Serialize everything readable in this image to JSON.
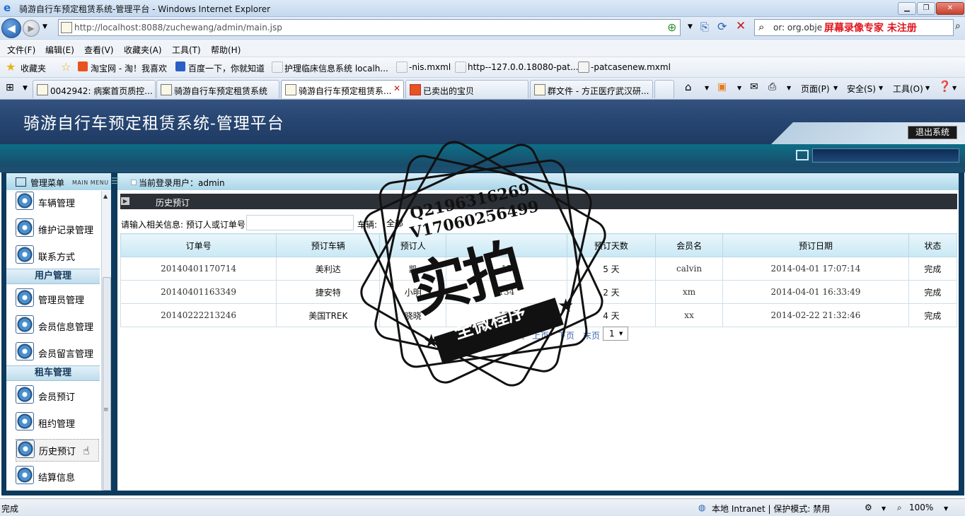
{
  "window": {
    "title": "骑游自行车预定租赁系统-管理平台 - Windows Internet Explorer"
  },
  "address": {
    "url": "http://localhost:8088/zuchewang/admin/main.jsp",
    "search_text": "or: org.obje",
    "search_watermark": "屏幕录像专家 未注册"
  },
  "menubar": [
    "文件(F)",
    "编辑(E)",
    "查看(V)",
    "收藏夹(A)",
    "工具(T)",
    "帮助(H)"
  ],
  "favorites": {
    "label": "收藏夹",
    "items": [
      "淘宝网 - 淘！我喜欢",
      "百度一下，你就知道",
      "护理临床信息系统 localh...",
      "-nis.mxml",
      "http--127.0.0.18080-pat...",
      "-patcasenew.mxml"
    ]
  },
  "tabs": [
    "0042942: 病案首页质控...",
    "骑游自行车预定租赁系统",
    "骑游自行车预定租赁系...",
    "已卖出的宝贝",
    "群文件 - 方正医疗武汉研..."
  ],
  "tabbar_cmds": [
    "页面(P)",
    "安全(S)",
    "工具(O)"
  ],
  "app": {
    "title": "骑游自行车预定租赁系统-管理平台",
    "logout": "退出系统",
    "current_user": "当前登录用户：admin"
  },
  "sidebar": {
    "title": "管理菜单",
    "subtitle": "MAIN MENU",
    "items_top": [
      "车辆管理",
      "维护记录管理",
      "联系方式"
    ],
    "section_user": "用户管理",
    "items_user": [
      "管理员管理",
      "会员信息管理",
      "会员留言管理"
    ],
    "section_rent": "租车管理",
    "items_rent": [
      "会员预订",
      "租约管理",
      "历史预订",
      "结算信息"
    ]
  },
  "content": {
    "panel_title": "历史预订",
    "search_label": "请输入相关信息: 预订人或订单号:",
    "vehicle_label": "车辆:",
    "vehicle_value": "全部",
    "columns": [
      "订单号",
      "预订车辆",
      "预订人",
      "",
      "预订天数",
      "会员名",
      "预订日期",
      "状态"
    ],
    "rows": [
      [
        "20140401170714",
        "美利达",
        "凯",
        "12",
        "5 天",
        "calvin",
        "2014-04-01 17:07:14",
        "完成"
      ],
      [
        "20140401163349",
        "捷安特",
        "小明",
        "134",
        "2 天",
        "xm",
        "2014-04-01 16:33:49",
        "完成"
      ],
      [
        "20140222213246",
        "美国TREK",
        "晓晓",
        "137",
        "4 天",
        "xx",
        "2014-02-22 21:32:46",
        "完成"
      ]
    ],
    "pager": [
      "页",
      "上页",
      "下页",
      "末页"
    ],
    "page_value": "1"
  },
  "watermark": {
    "line1": "Q2196316269",
    "line2": "V17060256499",
    "big": "实拍",
    "ribbon": "全微程序"
  },
  "status": {
    "left": "完成",
    "zone": "本地 Intranet | 保护模式: 禁用",
    "zoom": "100%"
  }
}
